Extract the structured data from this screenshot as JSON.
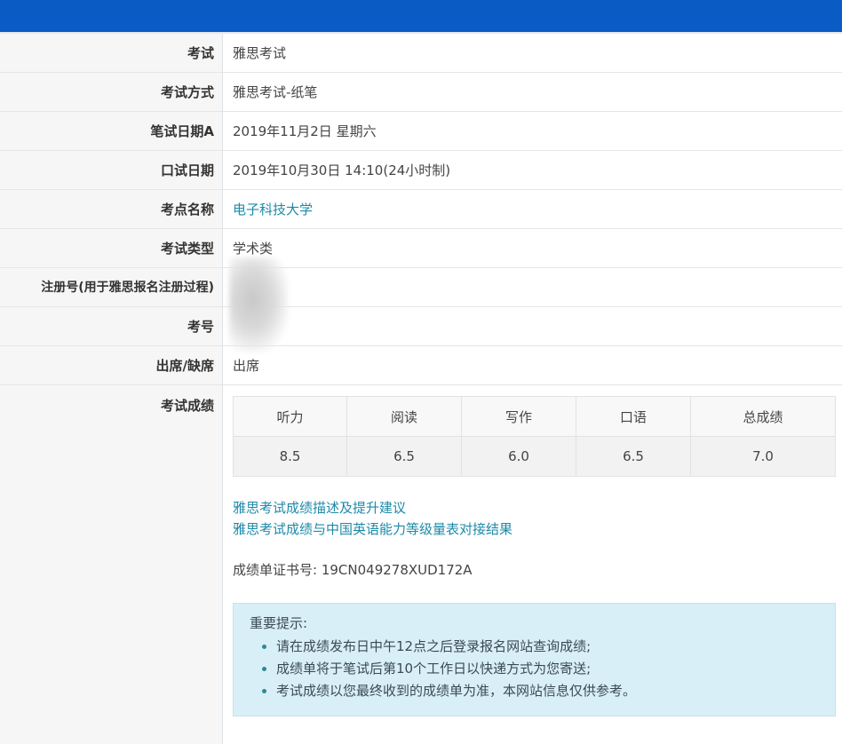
{
  "rows": [
    {
      "label": "考试",
      "value": "雅思考试"
    },
    {
      "label": "考试方式",
      "value": "雅思考试-纸笔"
    },
    {
      "label": "笔试日期A",
      "value": "2019年11月2日 星期六"
    },
    {
      "label": "口试日期",
      "value": "2019年10月30日 14:10(24小时制)"
    },
    {
      "label": "考点名称",
      "value": "电子科技大学"
    },
    {
      "label": "考试类型",
      "value": "学术类"
    },
    {
      "label": "注册号(用于雅思报名注册过程)",
      "value": ""
    },
    {
      "label": "考号",
      "value": ""
    },
    {
      "label": "出席/缺席",
      "value": "出席"
    }
  ],
  "scores": {
    "label": "考试成绩",
    "headers": [
      "听力",
      "阅读",
      "写作",
      "口语",
      "总成绩"
    ],
    "values": [
      "8.5",
      "6.5",
      "6.0",
      "6.5",
      "7.0"
    ]
  },
  "links": {
    "score_description": "雅思考试成绩描述及提升建议",
    "cse_mapping": "雅思考试成绩与中国英语能力等级量表对接结果"
  },
  "certificate": "成绩单证书号: 19CN049278XUD172A",
  "notice": {
    "title": "重要提示:",
    "items": [
      "请在成绩发布日中午12点之后登录报名网站查询成绩;",
      "成绩单将于笔试后第10个工作日以快递方式为您寄送;",
      "考试成绩以您最终收到的成绩单为准，本网站信息仅供参考。"
    ]
  },
  "colors": {
    "header_bar": "#0a5bc4",
    "link": "#1d8aa8",
    "notice_bg": "#d9eff7"
  }
}
